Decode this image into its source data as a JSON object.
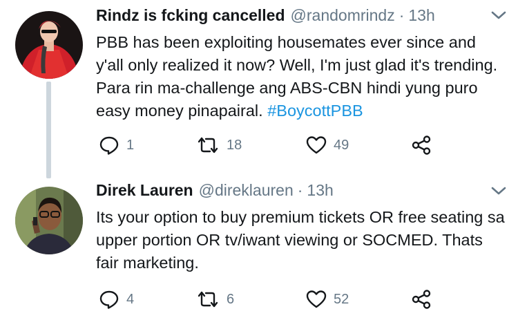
{
  "tweets": [
    {
      "display_name": "Rindz is fcking cancelled",
      "handle": "@randomrindz",
      "separator": "·",
      "time": "13h",
      "text_before": "PBB has been exploiting housemates ever since and y'all only realized it now? Well, I'm just glad it's trending. Para rin ma-challenge ang ABS-CBN hindi yung puro easy money pinapairal. ",
      "hashtag": "#BoycottPBB",
      "replies": "1",
      "retweets": "18",
      "likes": "49"
    },
    {
      "display_name": "Direk Lauren",
      "handle": "@direklauren",
      "separator": "·",
      "time": "13h",
      "text_before": "Its your option to buy premium tickets OR free seating sa upper portion OR tv/iwant viewing or SOCMED. Thats  fair marketing.",
      "hashtag": "",
      "replies": "4",
      "retweets": "6",
      "likes": "52"
    }
  ],
  "icons": {
    "reply": "reply-icon",
    "retweet": "retweet-icon",
    "like": "heart-icon",
    "share": "share-icon",
    "caret": "chevron-down-icon"
  },
  "colors": {
    "text": "#14171a",
    "muted": "#657786",
    "link": "#1b95e0",
    "thread_line": "#cdd6dd"
  }
}
